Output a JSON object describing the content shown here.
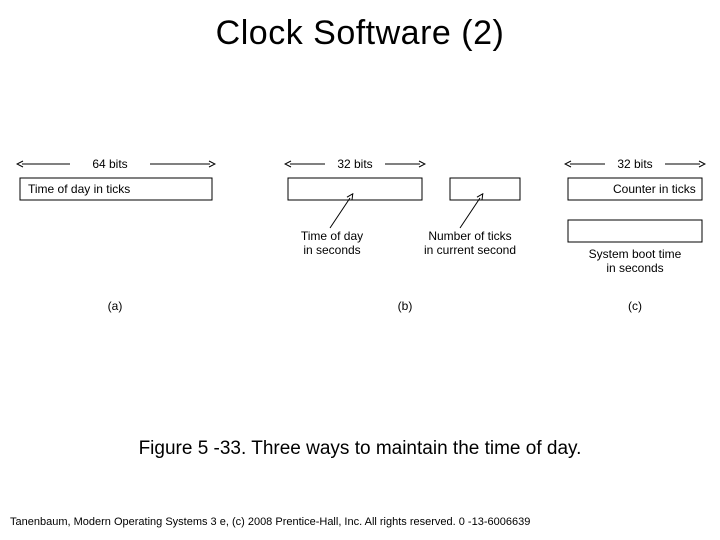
{
  "title": "Clock Software (2)",
  "caption": "Figure 5 -33. Three ways to maintain the time of day.",
  "footer": "Tanenbaum, Modern Operating Systems 3 e, (c) 2008 Prentice-Hall, Inc. All rights reserved. 0 -13-6006639",
  "figure": {
    "a": {
      "width_label": "64 bits",
      "box_label": "Time of day in ticks",
      "panel_label": "(a)"
    },
    "b": {
      "width_label": "32 bits",
      "left_label_line1": "Time of day",
      "left_label_line2": "in seconds",
      "right_label_line1": "Number of ticks",
      "right_label_line2": "in current second",
      "panel_label": "(b)"
    },
    "c": {
      "width_label": "32 bits",
      "top_label": "Counter in ticks",
      "bottom_label_line1": "System boot time",
      "bottom_label_line2": "in seconds",
      "panel_label": "(c)"
    }
  }
}
